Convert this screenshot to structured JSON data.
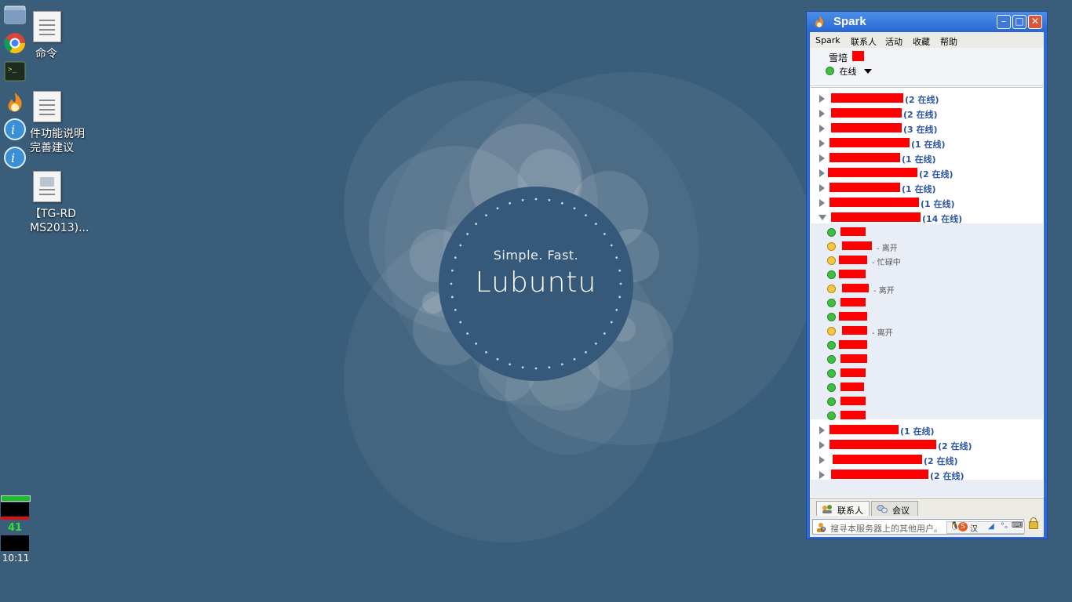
{
  "wallpaper": {
    "tagline": "Simple. Fast.",
    "brand": "Lubuntu"
  },
  "desktop": {
    "icons": [
      {
        "label": "命令"
      },
      {
        "label_line1": "件功能说明",
        "label_line2": "完善建议"
      },
      {
        "label_line1": "【TG-RD",
        "label_line2": "MS2013)..."
      }
    ]
  },
  "sysmon": {
    "value": "41",
    "clock": "10:11"
  },
  "spark": {
    "title": "Spark",
    "menu": [
      "Spark",
      "联系人",
      "活动",
      "收藏",
      "帮助"
    ],
    "user": {
      "name": "雪培",
      "status": "在线"
    },
    "groups": [
      {
        "count": "(2 在线)"
      },
      {
        "count": "(2 在线)"
      },
      {
        "count": "(3 在线)"
      },
      {
        "count": "(1 在线)"
      },
      {
        "count": "(1 在线)"
      },
      {
        "count": "(2 在线)"
      },
      {
        "count": "(1 在线)"
      },
      {
        "count": "(1 在线)"
      },
      {
        "count": "(14 在线)",
        "expanded": true
      },
      {
        "count": "(1 在线)"
      },
      {
        "count": "(2 在线)"
      },
      {
        "count": "(2 在线)"
      },
      {
        "count": "(2 在线)"
      }
    ],
    "contacts": [
      {
        "status": "online",
        "note": ""
      },
      {
        "status": "away",
        "note": "- 离开"
      },
      {
        "status": "away",
        "note": "- 忙碌中"
      },
      {
        "status": "online",
        "note": ""
      },
      {
        "status": "away",
        "note": "- 离开"
      },
      {
        "status": "online",
        "note": ""
      },
      {
        "status": "online",
        "note": ""
      },
      {
        "status": "away",
        "note": "- 离开"
      },
      {
        "status": "online",
        "note": ""
      },
      {
        "status": "online",
        "note": ""
      },
      {
        "status": "online",
        "note": ""
      },
      {
        "status": "online",
        "note": ""
      },
      {
        "status": "online",
        "note": ""
      },
      {
        "status": "online",
        "note": ""
      }
    ],
    "tabs": {
      "contacts": "联系人",
      "conference": "会议"
    },
    "search": {
      "placeholder": "搜寻本服务器上的其他用户。"
    },
    "ime": {
      "label": "汉"
    }
  },
  "colors": {
    "desktop_bg": "#3a5d7a",
    "window_frame": "#2f6ad4",
    "group_count": "#2b55a6",
    "redaction": "#ff0000"
  }
}
